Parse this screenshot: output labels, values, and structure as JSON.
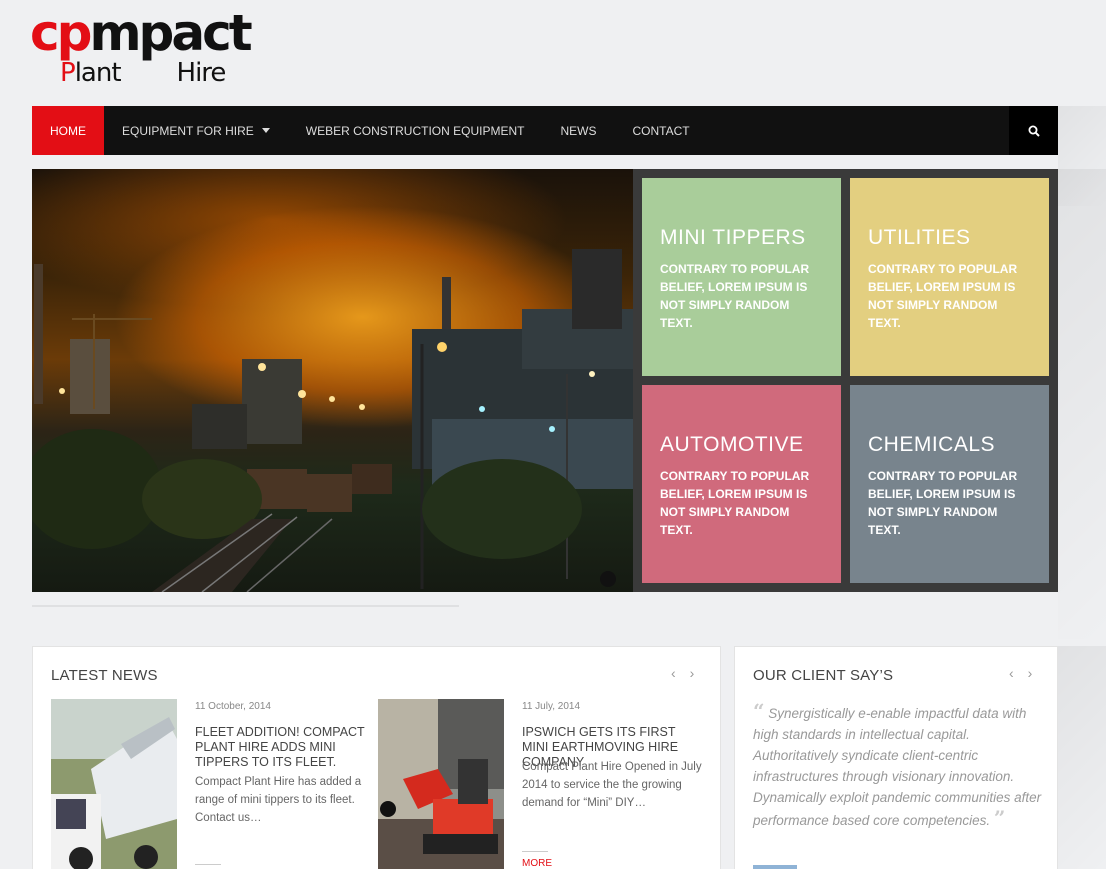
{
  "brand": {
    "logo_top": "cpmpact",
    "logo_bottom_1": "Plant",
    "logo_bottom_2": "Hire"
  },
  "nav": {
    "items": [
      {
        "label": "HOME",
        "active": true
      },
      {
        "label": "EQUIPMENT FOR HIRE",
        "dropdown": true
      },
      {
        "label": "WEBER CONSTRUCTION EQUIPMENT"
      },
      {
        "label": "NEWS"
      },
      {
        "label": "CONTACT"
      }
    ],
    "search_icon": "search-icon"
  },
  "tiles": [
    {
      "title": "MINI TIPPERS",
      "text": "CONTRARY TO POPULAR BELIEF, LOREM IPSUM IS NOT SIMPLY RANDOM TEXT.",
      "color": "#a9cd9a"
    },
    {
      "title": "UTILITIES",
      "text": "CONTRARY TO POPULAR BELIEF, LOREM IPSUM IS NOT SIMPLY RANDOM TEXT.",
      "color": "#e3cf80"
    },
    {
      "title": "AUTOMOTIVE",
      "text": "CONTRARY TO POPULAR BELIEF, LOREM IPSUM IS NOT SIMPLY RANDOM TEXT.",
      "color": "#d06a7c"
    },
    {
      "title": "CHEMICALS",
      "text": "CONTRARY TO POPULAR BELIEF, LOREM IPSUM IS NOT SIMPLY RANDOM TEXT.",
      "color": "#78848d"
    }
  ],
  "news": {
    "title": "LATEST NEWS",
    "prev": "‹",
    "next": "›",
    "items": [
      {
        "date": "11 October, 2014",
        "title": "FLEET ADDITION! COMPACT PLANT HIRE ADDS MINI TIPPERS TO ITS FLEET.",
        "excerpt": "Compact Plant Hire has added a range of mini tippers to its fleet. Contact us…"
      },
      {
        "date": "11 July, 2014",
        "title": "IPSWICH GETS ITS FIRST MINI EARTHMOVING HIRE COMPANY",
        "excerpt": "Compact Plant Hire Opened in July 2014 to service the the growing demand for “Mini” DIY…",
        "more": "MORE"
      }
    ]
  },
  "clients": {
    "title": "OUR CLIENT SAY’S",
    "prev": "‹",
    "next": "›",
    "quote": "Synergistically e-enable impactful data with high standards in intellectual capital. Authoritatively syndicate client-centric infrastructures through visionary innovation. Dynamically exploit pandemic communities after performance based core competencies.",
    "open_quote": "“",
    "close_quote": "”"
  },
  "colors": {
    "accent": "#e30e15",
    "nav_bg": "#111111"
  }
}
